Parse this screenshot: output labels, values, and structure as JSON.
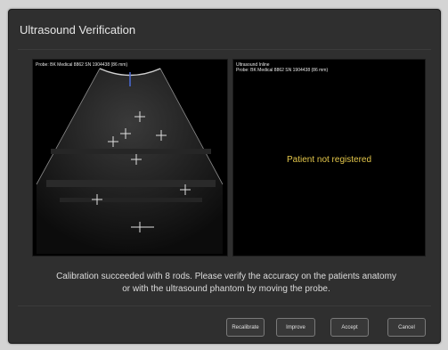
{
  "dialog": {
    "title": "Ultrasound Verification"
  },
  "left_view": {
    "probe_label": "Probe: BK Medical 8862 SN 1904438 (86 mm)"
  },
  "right_view": {
    "mode_label": "Ultrasound Inline",
    "probe_label": "Probe: BK Medical 8862 SN 1904438 (86 mm)",
    "message": "Patient not registered"
  },
  "instructions": {
    "line1": "Calibration succeeded with 8 rods. Please verify the accuracy on the patients anatomy",
    "line2": "or with the ultrasound phantom by moving the probe."
  },
  "buttons": {
    "recalibrate": "Recalibrate",
    "improve": "Improve",
    "accept": "Accept",
    "cancel": "Cancel"
  },
  "colors": {
    "message": "#e3c64a",
    "background": "#2f2f2f"
  }
}
